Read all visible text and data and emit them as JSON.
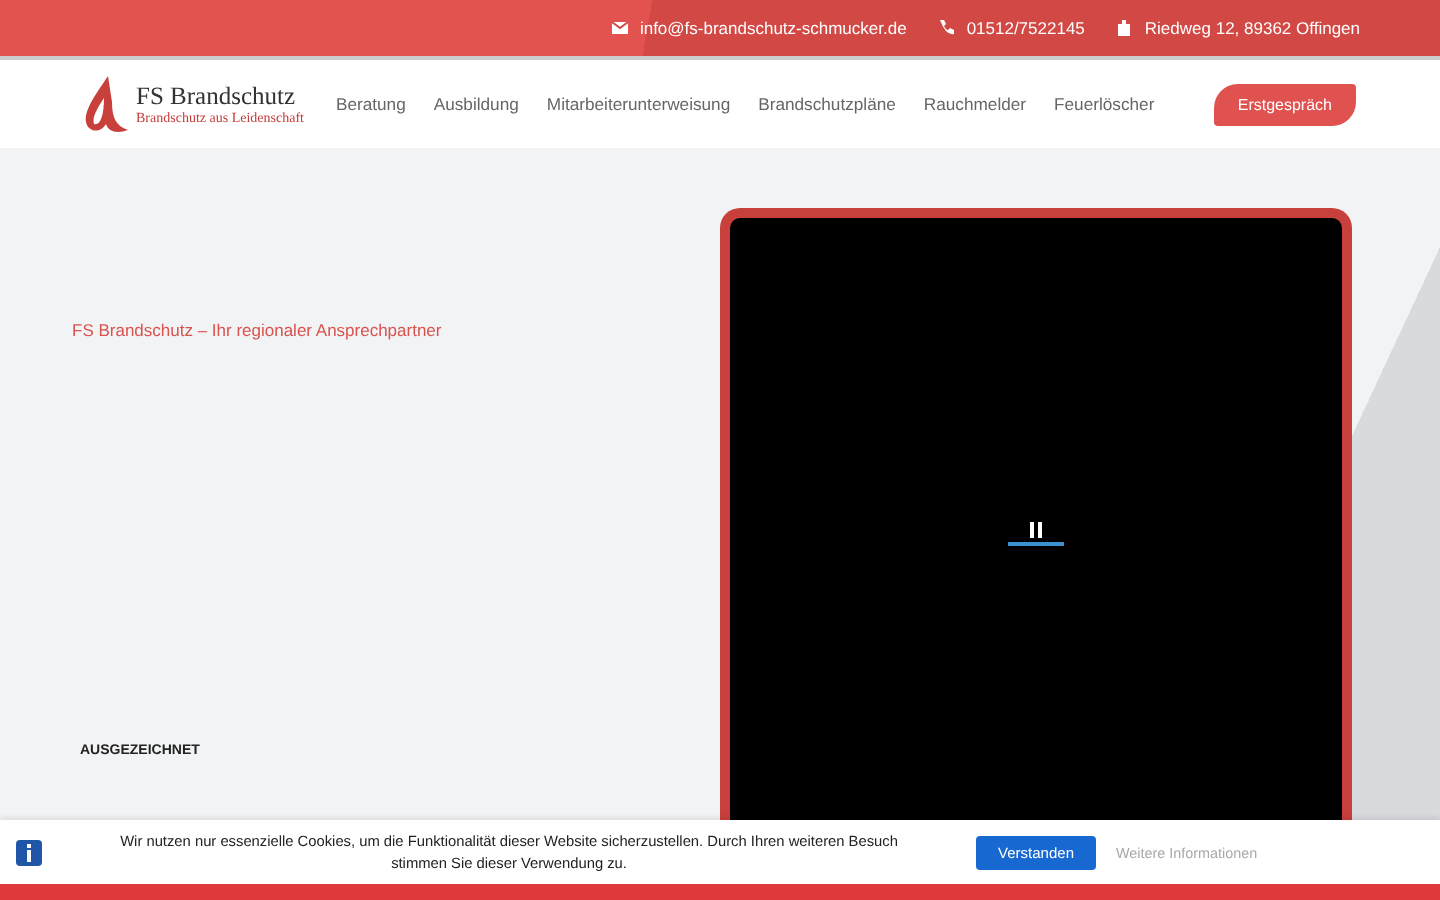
{
  "topbar": {
    "email": "info@fs-brandschutz-schmucker.de",
    "phone": "01512/7522145",
    "address": "Riedweg 12, 89362 Offingen"
  },
  "logo": {
    "title": "FS Brandschutz",
    "tagline": "Brandschutz aus Leidenschaft"
  },
  "nav": [
    "Beratung",
    "Ausbildung",
    "Mitarbeiterunterweisung",
    "Brandschutzpläne",
    "Rauchmelder",
    "Feuerlöscher"
  ],
  "cta": "Erstgespräch",
  "hero": {
    "subtitle": "FS Brandschutz – Ihr regionaler Ansprechpartner",
    "award_label": "AUSGEZEICHNET"
  },
  "video": {
    "playing": true
  },
  "cookie": {
    "text": "Wir nutzen nur essenzielle Cookies, um die Funktionalität dieser Website sicherzustellen. Durch Ihren weiteren Besuch stimmen Sie dieser Verwendung zu.",
    "accept": "Verstanden",
    "more": "Weitere Informationen"
  }
}
